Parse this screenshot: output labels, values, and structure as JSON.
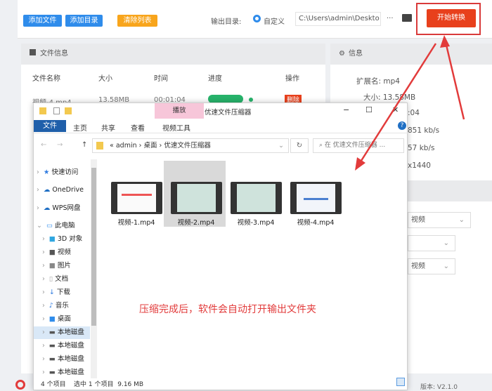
{
  "toolbar": {
    "add_file": "添加文件",
    "add_folder": "添加目录",
    "clear_list": "清除列表",
    "output_label": "输出目录:",
    "radio_custom": "自定义",
    "output_path": "C:\\Users\\admin\\Deskto",
    "more": "···",
    "start": "开始转换"
  },
  "file_panel": {
    "title": "文件信息",
    "columns": [
      "文件名称",
      "大小",
      "时间",
      "进度",
      "操作"
    ],
    "row": {
      "name": "视频-4.mp4",
      "size": "13.58MB",
      "time": "00:01:04",
      "action": "删除"
    }
  },
  "info_panel": {
    "title": "信息",
    "lines": [
      "扩展名: mp4",
      "大小: 13.58MB",
      ":04",
      "851 kb/s",
      "57 kb/s",
      "x1440"
    ],
    "selects": [
      "视频",
      "",
      "视频"
    ]
  },
  "explorer": {
    "title": "优速文件压缩器",
    "context_tab": "播放",
    "context_group": "视频工具",
    "ribbon": [
      "文件",
      "主页",
      "共享",
      "查看"
    ],
    "crumbs": [
      "«",
      "admin",
      "桌面",
      "优速文件压缩器"
    ],
    "search_placeholder": "在 优速文件压缩器 ...",
    "nav": [
      "快速访问",
      "OneDrive",
      "WPS网盘",
      "此电脑",
      "3D 对象",
      "视频",
      "图片",
      "文档",
      "下载",
      "音乐",
      "桌面",
      "本地磁盘",
      "本地磁盘",
      "本地磁盘",
      "本地磁盘"
    ],
    "files": [
      "视频-1.mp4",
      "视频-2.mp4",
      "视频-3.mp4",
      "视频-4.mp4"
    ],
    "status": {
      "count": "4 个项目",
      "selected": "选中 1 个项目",
      "size": "9.16 MB"
    }
  },
  "annotation": "压缩完成后，软件会自动打开输出文件夹",
  "footer": {
    "version": "版本: V2.1.0"
  },
  "colors": {
    "blue": "#2f8ceb",
    "orange": "#f8a51c",
    "red": "#e8401c",
    "annot": "#e23b3b"
  }
}
